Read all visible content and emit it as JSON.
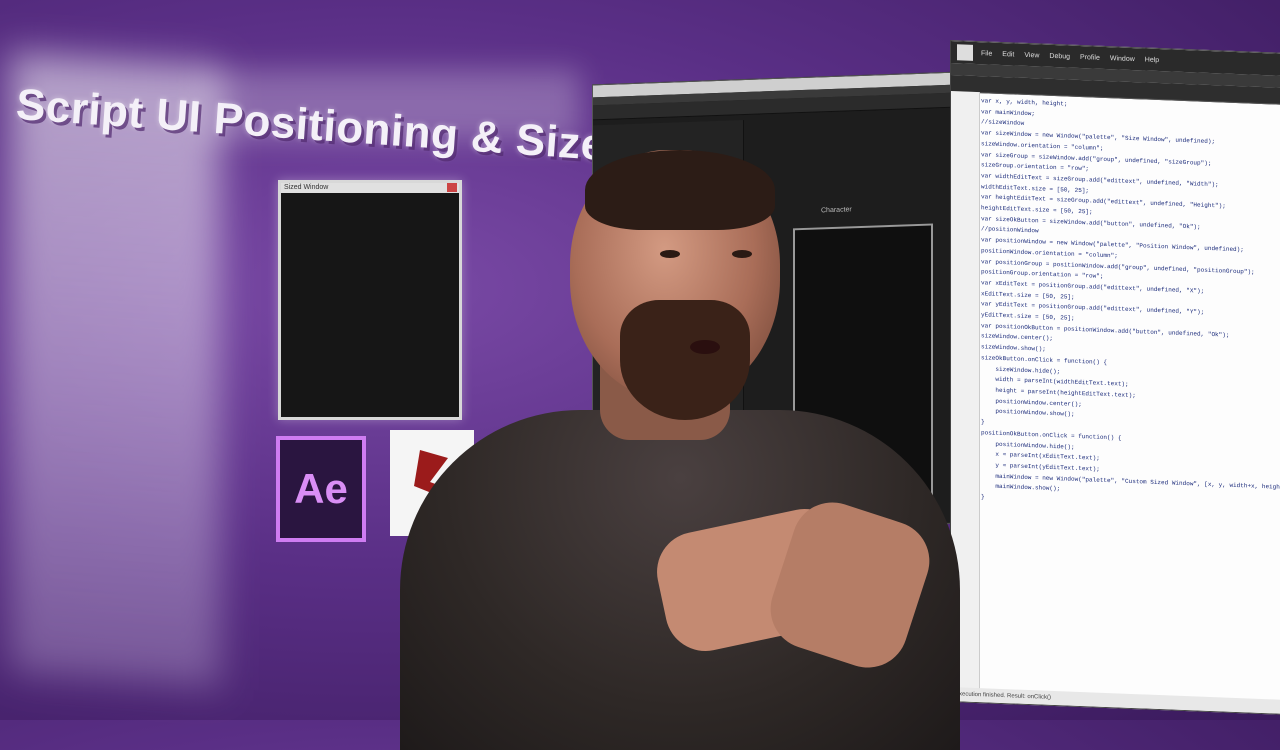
{
  "overlay_title": "Script UI Positioning & Size",
  "ae_logo_text": "Ae",
  "preview_window_title": "Sized Window",
  "ae_window": {
    "character_panel_label": "Character"
  },
  "extendscript": {
    "menu": [
      "File",
      "Edit",
      "View",
      "Debug",
      "Profile",
      "Window",
      "Help"
    ],
    "code_lines": [
      "var x, y, width, height;",
      "var mainWindow;",
      "",
      "//sizeWindow",
      "var sizeWindow = new Window(\"palette\", \"Size Window\", undefined);",
      "sizeWindow.orientation = \"column\";",
      "var sizeGroup = sizeWindow.add(\"group\", undefined, \"sizeGroup\");",
      "sizeGroup.orientation = \"row\";",
      "var widthEditText = sizeGroup.add(\"edittext\", undefined, \"Width\");",
      "widthEditText.size = [50, 25];",
      "var heightEditText = sizeGroup.add(\"edittext\", undefined, \"Height\");",
      "heightEditText.size = [50, 25];",
      "var sizeOkButton = sizeWindow.add(\"button\", undefined, \"Ok\");",
      "",
      "//positionWindow",
      "var positionWindow = new Window(\"palette\", \"Position Window\", undefined);",
      "positionWindow.orientation = \"column\";",
      "var positionGroup = positionWindow.add(\"group\", undefined, \"positionGroup\");",
      "positionGroup.orientation = \"row\";",
      "var xEditText = positionGroup.add(\"edittext\", undefined, \"X\");",
      "xEditText.size = [50, 25];",
      "var yEditText = positionGroup.add(\"edittext\", undefined, \"Y\");",
      "yEditText.size = [50, 25];",
      "var positionOkButton = positionWindow.add(\"button\", undefined, \"Ok\");",
      "",
      "sizeWindow.center();",
      "sizeWindow.show();",
      "",
      "sizeOkButton.onClick = function() {",
      "    sizeWindow.hide();",
      "    width = parseInt(widthEditText.text);",
      "    height = parseInt(heightEditText.text);",
      "    positionWindow.center();",
      "    positionWindow.show();",
      "}",
      "",
      "positionOkButton.onClick = function() {",
      "    positionWindow.hide();",
      "    x = parseInt(xEditText.text);",
      "    y = parseInt(yEditText.text);",
      "    mainWindow = new Window(\"palette\", \"Custom Sized Window\", [x, y, width+x, height+y]);",
      "    mainWindow.show();",
      "}"
    ],
    "status_text": "Execution finished. Result: onClick()"
  }
}
